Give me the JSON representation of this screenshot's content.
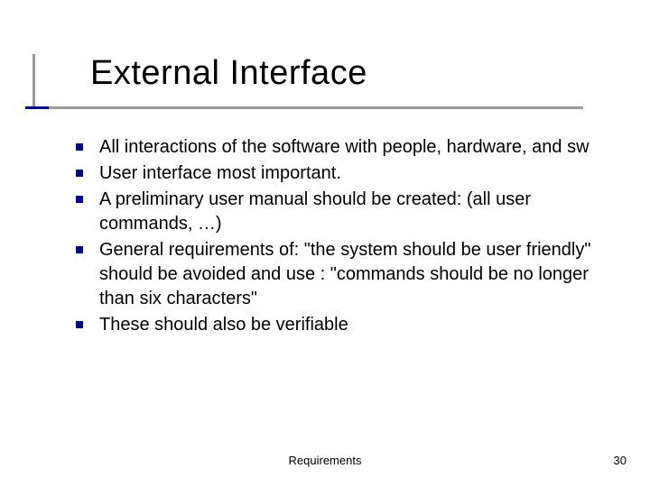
{
  "title": "External Interface",
  "bullets": [
    "All interactions of the software with people, hardware, and sw",
    "User interface most important.",
    "A preliminary user manual should be created: (all user commands, …)",
    "General requirements of: \"the system should be user friendly\" should be avoided and use : \"commands should be no longer than six characters\"",
    "These should also be verifiable"
  ],
  "footer": {
    "center": "Requirements",
    "page": "30"
  }
}
